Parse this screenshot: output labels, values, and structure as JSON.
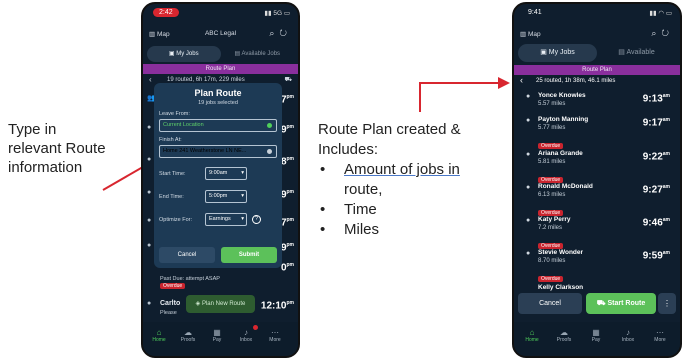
{
  "captions": {
    "left": [
      "Type in",
      "relevant Route",
      "information"
    ],
    "right_intro": [
      "Route Plan created &",
      "Includes:"
    ],
    "bullets": [
      "Amount of jobs in",
      "route,",
      "Time",
      "Miles"
    ]
  },
  "phone1": {
    "time": "2:42",
    "status_right": "5G",
    "menu_map": "Map",
    "title": "ABC Legal",
    "tab_my_jobs": "My Jobs",
    "tab_available": "Available Jobs",
    "plan_bar": "Route Plan",
    "route_summary": "19 routed, 6h 17m, 229 miles",
    "row_times": [
      "7",
      "9",
      "8",
      "9",
      "7",
      "9",
      "0"
    ],
    "modal": {
      "title": "Plan Route",
      "subtitle": "19 jobs selected",
      "leave_label": "Leave From:",
      "leave_value": "Current Location",
      "finish_label": "Finish At:",
      "finish_value": "Home 241 Weatherstone LN NE...",
      "start_label": "Start Time:",
      "start_value": "9:00am",
      "end_label": "End Time:",
      "end_value": "5:00pm",
      "optimize_label": "Optimize For:",
      "optimize_value": "Earnings",
      "cancel": "Cancel",
      "submit": "Submit"
    },
    "past_due": "Past Due: attempt ASAP",
    "overdue": "Overdue",
    "carlton": "Carlto",
    "carlton_time": "12:10",
    "carlton_suffix": "pm",
    "please": "Please",
    "fab": "Plan New Route",
    "nav": [
      "Home",
      "Proofs",
      "Pay",
      "Inbox",
      "More"
    ]
  },
  "phone2": {
    "time": "9:41",
    "menu_map": "Map",
    "tab_my_jobs": "My Jobs",
    "tab_available": "Available",
    "plan_bar": "Route Plan",
    "route_summary": "25 routed, 1h 38m, 46.1 miles",
    "jobs": [
      {
        "name": "Yonce Knowles",
        "miles": "5.57 miles",
        "time": "9:13",
        "ampm": "am",
        "overdue": false
      },
      {
        "name": "Payton Manning",
        "miles": "5.77 miles",
        "time": "9:17",
        "ampm": "am",
        "overdue": true
      },
      {
        "name": "Ariana Grande",
        "miles": "5.81 miles",
        "time": "9:22",
        "ampm": "am",
        "overdue": true
      },
      {
        "name": "Ronald McDonald",
        "miles": "6.13 miles",
        "time": "9:27",
        "ampm": "am",
        "overdue": true
      },
      {
        "name": "Katy Perry",
        "miles": "7.2 miles",
        "time": "9:46",
        "ampm": "am",
        "overdue": true
      },
      {
        "name": "Stevie Wonder",
        "miles": "8.70 miles",
        "time": "9:59",
        "ampm": "am",
        "overdue": true
      }
    ],
    "partial_name": "Kelly Clarkson",
    "overdue": "Overdue",
    "cancel": "Cancel",
    "start": "Start Route",
    "more": "⋮",
    "nav": [
      "Home",
      "Proofs",
      "Pay",
      "Inbox",
      "More"
    ]
  }
}
